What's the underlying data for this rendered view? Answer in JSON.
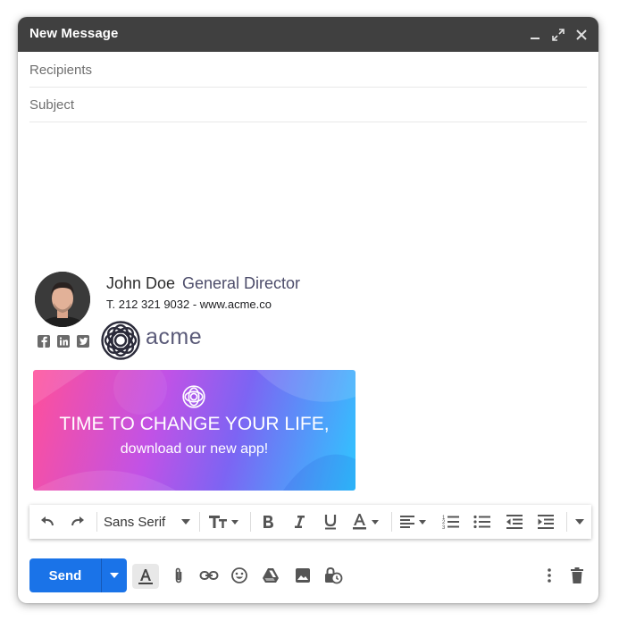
{
  "window": {
    "title": "New Message"
  },
  "fields": {
    "recipients_placeholder": "Recipients",
    "subject_placeholder": "Subject"
  },
  "signature": {
    "name": "John Doe",
    "job_title": "General Director",
    "contact": "T. 212 321 9032 - www.acme.co",
    "logo_text": "acme",
    "social_icons": [
      "facebook-icon",
      "linkedin-icon",
      "twitter-icon"
    ]
  },
  "banner": {
    "line1": "TIME TO CHANGE YOUR LIFE,",
    "line2": "download our new app!"
  },
  "toolbar": {
    "font": "Sans Serif"
  },
  "footer": {
    "send_label": "Send"
  },
  "colors": {
    "accent": "#1a73e8",
    "titlebar": "#404040",
    "logo": "#5a5a78"
  }
}
